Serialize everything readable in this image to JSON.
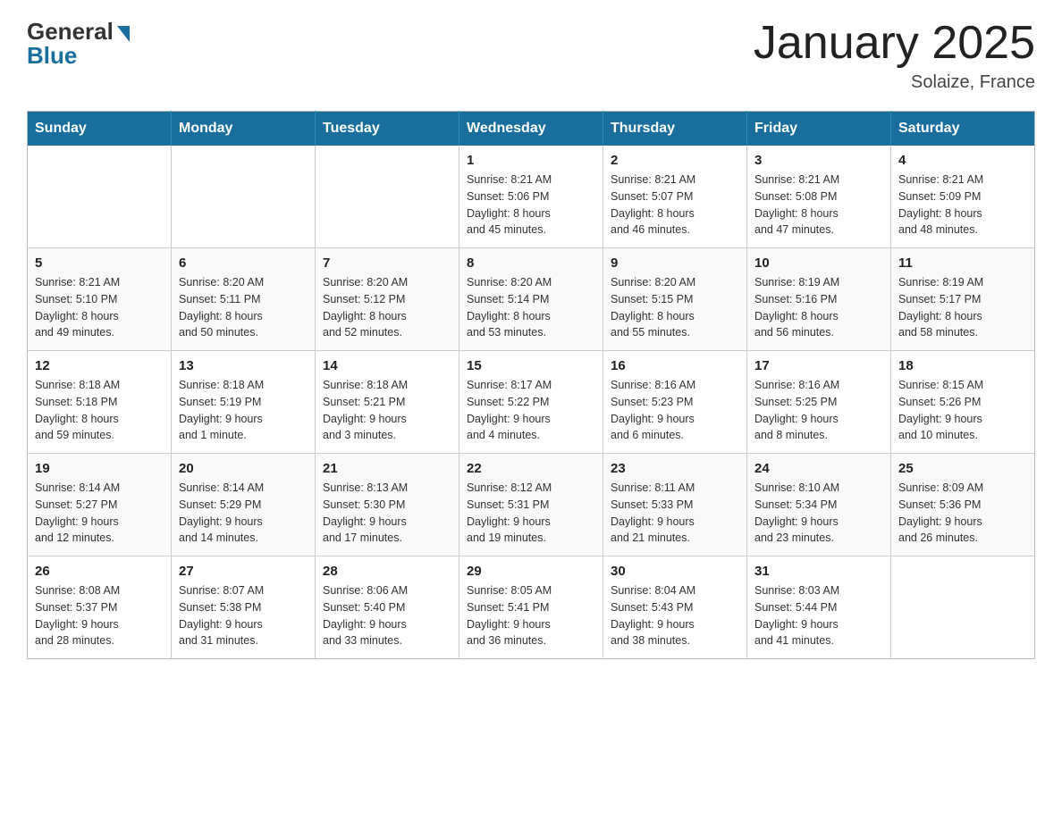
{
  "header": {
    "logo": {
      "general": "General",
      "blue": "Blue"
    },
    "title": "January 2025",
    "subtitle": "Solaize, France"
  },
  "calendar": {
    "days_of_week": [
      "Sunday",
      "Monday",
      "Tuesday",
      "Wednesday",
      "Thursday",
      "Friday",
      "Saturday"
    ],
    "weeks": [
      [
        {
          "day": "",
          "info": ""
        },
        {
          "day": "",
          "info": ""
        },
        {
          "day": "",
          "info": ""
        },
        {
          "day": "1",
          "info": "Sunrise: 8:21 AM\nSunset: 5:06 PM\nDaylight: 8 hours\nand 45 minutes."
        },
        {
          "day": "2",
          "info": "Sunrise: 8:21 AM\nSunset: 5:07 PM\nDaylight: 8 hours\nand 46 minutes."
        },
        {
          "day": "3",
          "info": "Sunrise: 8:21 AM\nSunset: 5:08 PM\nDaylight: 8 hours\nand 47 minutes."
        },
        {
          "day": "4",
          "info": "Sunrise: 8:21 AM\nSunset: 5:09 PM\nDaylight: 8 hours\nand 48 minutes."
        }
      ],
      [
        {
          "day": "5",
          "info": "Sunrise: 8:21 AM\nSunset: 5:10 PM\nDaylight: 8 hours\nand 49 minutes."
        },
        {
          "day": "6",
          "info": "Sunrise: 8:20 AM\nSunset: 5:11 PM\nDaylight: 8 hours\nand 50 minutes."
        },
        {
          "day": "7",
          "info": "Sunrise: 8:20 AM\nSunset: 5:12 PM\nDaylight: 8 hours\nand 52 minutes."
        },
        {
          "day": "8",
          "info": "Sunrise: 8:20 AM\nSunset: 5:14 PM\nDaylight: 8 hours\nand 53 minutes."
        },
        {
          "day": "9",
          "info": "Sunrise: 8:20 AM\nSunset: 5:15 PM\nDaylight: 8 hours\nand 55 minutes."
        },
        {
          "day": "10",
          "info": "Sunrise: 8:19 AM\nSunset: 5:16 PM\nDaylight: 8 hours\nand 56 minutes."
        },
        {
          "day": "11",
          "info": "Sunrise: 8:19 AM\nSunset: 5:17 PM\nDaylight: 8 hours\nand 58 minutes."
        }
      ],
      [
        {
          "day": "12",
          "info": "Sunrise: 8:18 AM\nSunset: 5:18 PM\nDaylight: 8 hours\nand 59 minutes."
        },
        {
          "day": "13",
          "info": "Sunrise: 8:18 AM\nSunset: 5:19 PM\nDaylight: 9 hours\nand 1 minute."
        },
        {
          "day": "14",
          "info": "Sunrise: 8:18 AM\nSunset: 5:21 PM\nDaylight: 9 hours\nand 3 minutes."
        },
        {
          "day": "15",
          "info": "Sunrise: 8:17 AM\nSunset: 5:22 PM\nDaylight: 9 hours\nand 4 minutes."
        },
        {
          "day": "16",
          "info": "Sunrise: 8:16 AM\nSunset: 5:23 PM\nDaylight: 9 hours\nand 6 minutes."
        },
        {
          "day": "17",
          "info": "Sunrise: 8:16 AM\nSunset: 5:25 PM\nDaylight: 9 hours\nand 8 minutes."
        },
        {
          "day": "18",
          "info": "Sunrise: 8:15 AM\nSunset: 5:26 PM\nDaylight: 9 hours\nand 10 minutes."
        }
      ],
      [
        {
          "day": "19",
          "info": "Sunrise: 8:14 AM\nSunset: 5:27 PM\nDaylight: 9 hours\nand 12 minutes."
        },
        {
          "day": "20",
          "info": "Sunrise: 8:14 AM\nSunset: 5:29 PM\nDaylight: 9 hours\nand 14 minutes."
        },
        {
          "day": "21",
          "info": "Sunrise: 8:13 AM\nSunset: 5:30 PM\nDaylight: 9 hours\nand 17 minutes."
        },
        {
          "day": "22",
          "info": "Sunrise: 8:12 AM\nSunset: 5:31 PM\nDaylight: 9 hours\nand 19 minutes."
        },
        {
          "day": "23",
          "info": "Sunrise: 8:11 AM\nSunset: 5:33 PM\nDaylight: 9 hours\nand 21 minutes."
        },
        {
          "day": "24",
          "info": "Sunrise: 8:10 AM\nSunset: 5:34 PM\nDaylight: 9 hours\nand 23 minutes."
        },
        {
          "day": "25",
          "info": "Sunrise: 8:09 AM\nSunset: 5:36 PM\nDaylight: 9 hours\nand 26 minutes."
        }
      ],
      [
        {
          "day": "26",
          "info": "Sunrise: 8:08 AM\nSunset: 5:37 PM\nDaylight: 9 hours\nand 28 minutes."
        },
        {
          "day": "27",
          "info": "Sunrise: 8:07 AM\nSunset: 5:38 PM\nDaylight: 9 hours\nand 31 minutes."
        },
        {
          "day": "28",
          "info": "Sunrise: 8:06 AM\nSunset: 5:40 PM\nDaylight: 9 hours\nand 33 minutes."
        },
        {
          "day": "29",
          "info": "Sunrise: 8:05 AM\nSunset: 5:41 PM\nDaylight: 9 hours\nand 36 minutes."
        },
        {
          "day": "30",
          "info": "Sunrise: 8:04 AM\nSunset: 5:43 PM\nDaylight: 9 hours\nand 38 minutes."
        },
        {
          "day": "31",
          "info": "Sunrise: 8:03 AM\nSunset: 5:44 PM\nDaylight: 9 hours\nand 41 minutes."
        },
        {
          "day": "",
          "info": ""
        }
      ]
    ]
  }
}
